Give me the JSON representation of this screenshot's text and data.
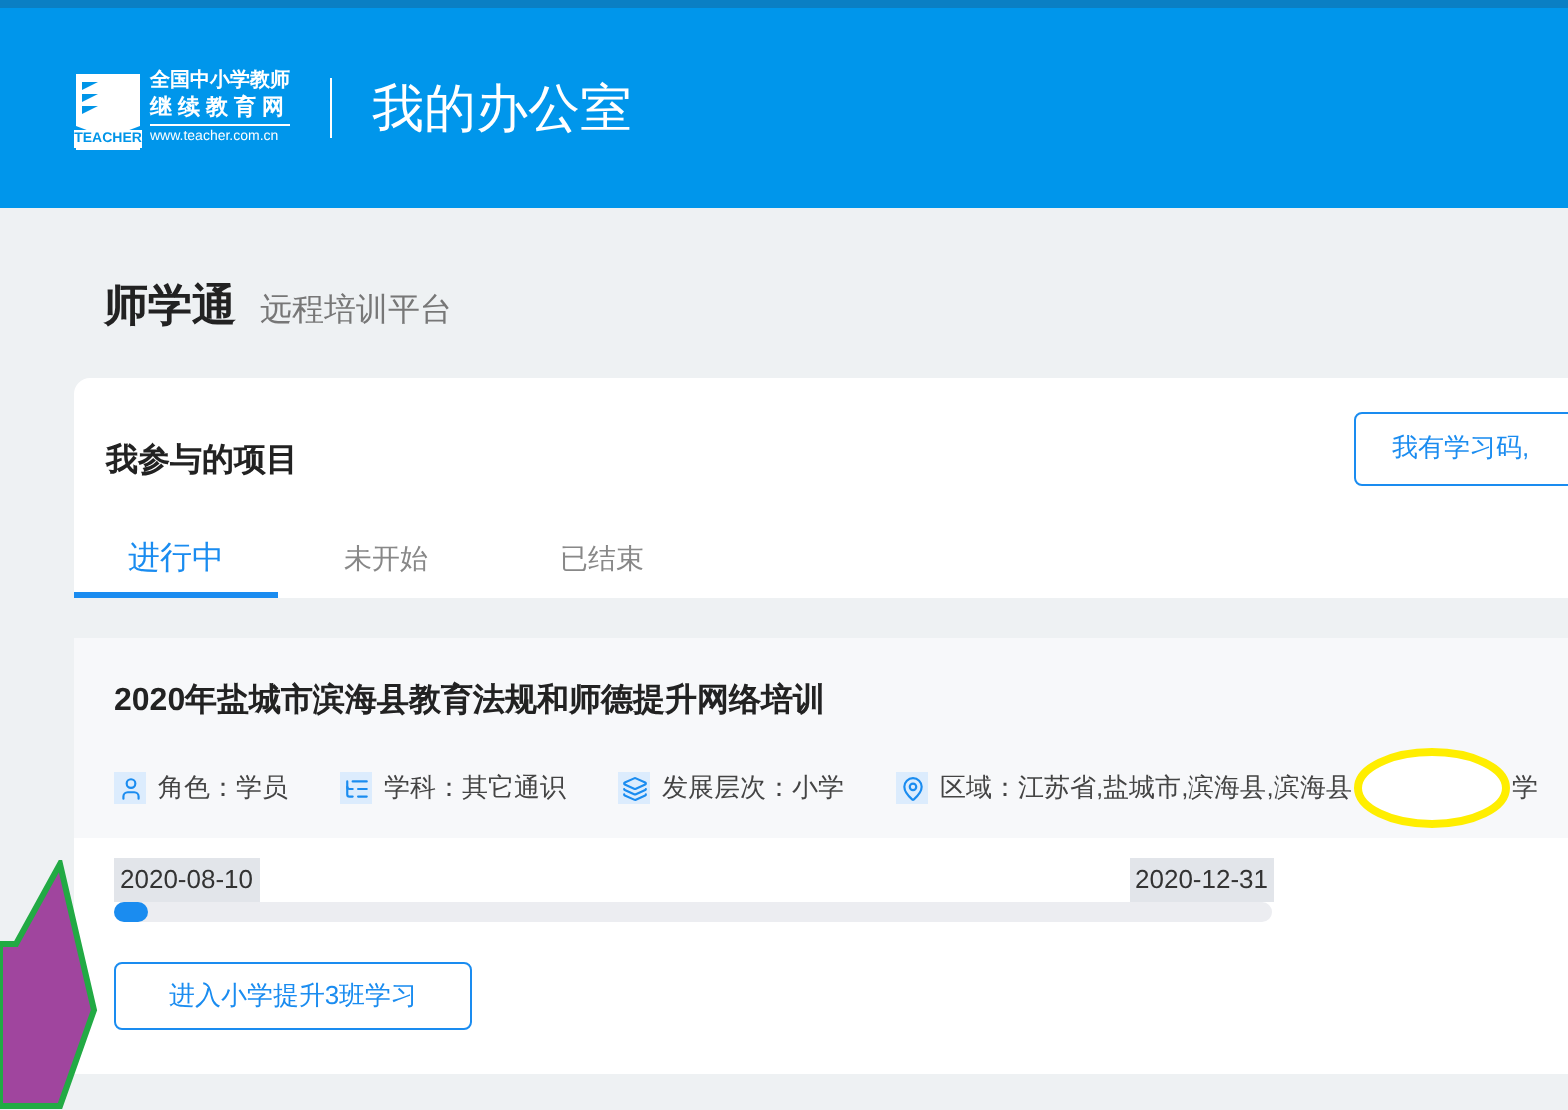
{
  "header": {
    "logo": {
      "badge": "TEACHER",
      "line_1": "全国中小学教师",
      "line_2": "继续教育网",
      "url": "www.teacher.com.cn"
    },
    "title": "我的办公室"
  },
  "page_title": {
    "name": "师学通",
    "subtitle": "远程培训平台"
  },
  "projects_panel": {
    "heading": "我参与的项目",
    "code_button": "我有学习码,",
    "tabs": [
      {
        "label": "进行中",
        "selected": true
      },
      {
        "label": "未开始",
        "selected": false
      },
      {
        "label": "已结束",
        "selected": false
      }
    ],
    "projects": [
      {
        "title": "2020年盐城市滨海县教育法规和师德提升网络培训",
        "info": [
          {
            "kind": "role",
            "text": "角色：学员"
          },
          {
            "kind": "subject",
            "text": "学科：其它通识"
          },
          {
            "kind": "level",
            "text": "发展层次：小学"
          },
          {
            "kind": "region",
            "text": "区域：江苏省,盐城市,滨海县,滨海县",
            "after_mark": "学"
          }
        ],
        "start_date": "2020-08-10",
        "end_date": "2020-12-31",
        "progress": {
          "level": 0.03
        },
        "enter_button": "进入小学提升3班学习"
      }
    ]
  }
}
